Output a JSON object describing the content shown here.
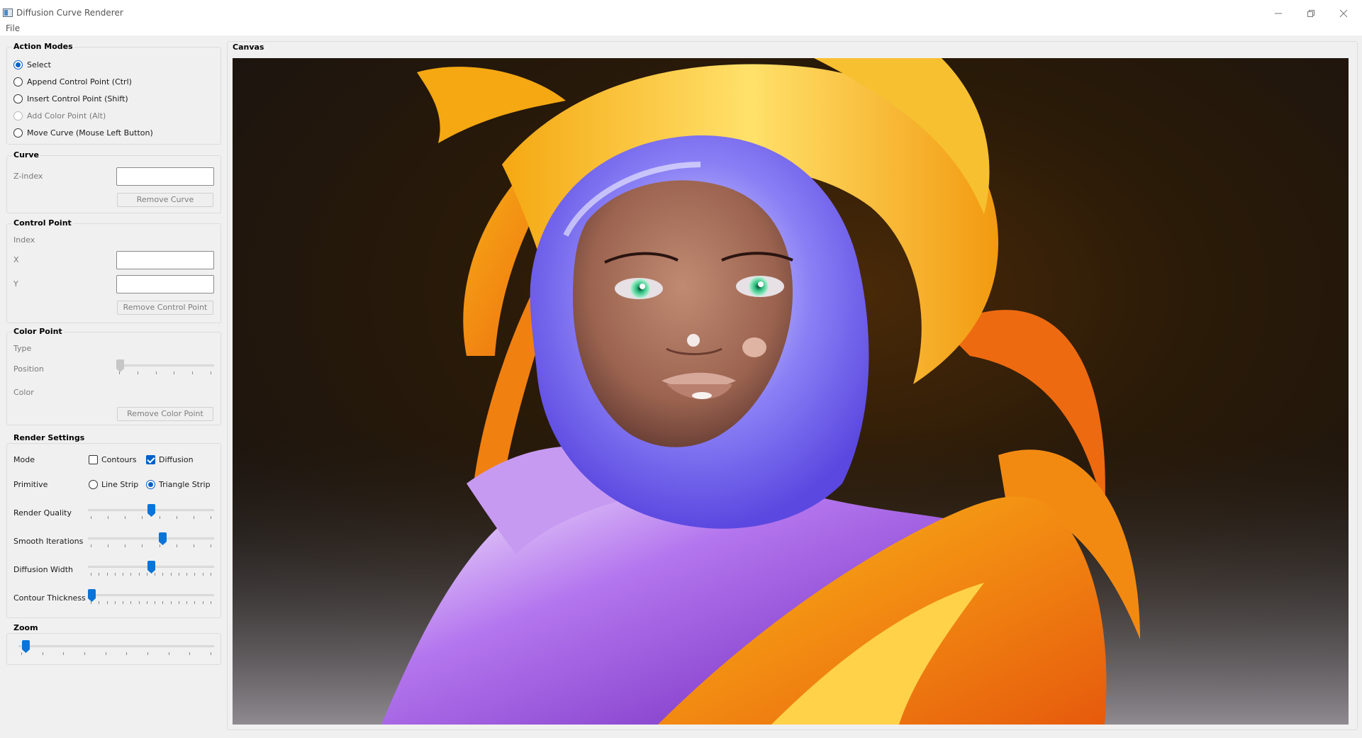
{
  "window": {
    "title": "Diffusion Curve Renderer"
  },
  "menu": {
    "file_label": "File"
  },
  "action_modes": {
    "title": "Action Modes",
    "options": [
      {
        "label": "Select",
        "checked": true,
        "enabled": true
      },
      {
        "label": "Append Control Point (Ctrl)",
        "checked": false,
        "enabled": true
      },
      {
        "label": "Insert Control Point (Shift)",
        "checked": false,
        "enabled": true
      },
      {
        "label": "Add Color Point (Alt)",
        "checked": false,
        "enabled": false
      },
      {
        "label": "Move Curve (Mouse Left Button)",
        "checked": false,
        "enabled": true
      }
    ]
  },
  "curve": {
    "title": "Curve",
    "zindex_label": "Z-index",
    "zindex_value": "",
    "remove_label": "Remove Curve"
  },
  "control_point": {
    "title": "Control Point",
    "index_label": "Index",
    "x_label": "X",
    "x_value": "",
    "y_label": "Y",
    "y_value": "",
    "remove_label": "Remove Control Point"
  },
  "color_point": {
    "title": "Color Point",
    "type_label": "Type",
    "position_label": "Position",
    "position_value": 0.0,
    "color_label": "Color",
    "remove_label": "Remove Color Point"
  },
  "render_settings": {
    "title": "Render Settings",
    "mode_label": "Mode",
    "contours_label": "Contours",
    "contours_checked": false,
    "diffusion_label": "Diffusion",
    "diffusion_checked": true,
    "primitive_label": "Primitive",
    "line_strip_label": "Line Strip",
    "line_strip_checked": false,
    "triangle_strip_label": "Triangle Strip",
    "triangle_strip_checked": true,
    "render_quality_label": "Render Quality",
    "render_quality_value": 0.5,
    "smooth_iterations_label": "Smooth Iterations",
    "smooth_iterations_value": 0.6,
    "diffusion_width_label": "Diffusion Width",
    "diffusion_width_value": 0.5,
    "contour_thickness_label": "Contour Thickness",
    "contour_thickness_value": 0.0
  },
  "zoom": {
    "title": "Zoom",
    "value": 0.02
  },
  "canvas": {
    "title": "Canvas"
  },
  "colors": {
    "accent": "#0a74d8",
    "orange": "#f07a10",
    "yellow": "#f7b718",
    "purple": "#8a3ad0",
    "blue_violet": "#7b6cf0",
    "skin": "#a86f58",
    "eye": "#3fcf8e"
  }
}
